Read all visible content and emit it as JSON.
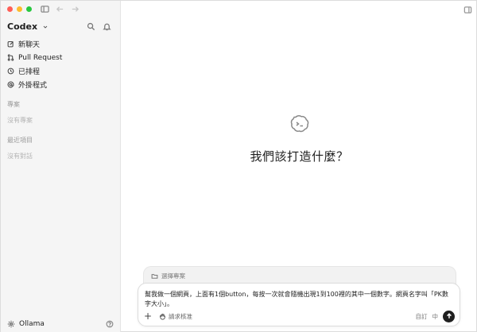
{
  "sidebar": {
    "brand": "Codex",
    "nav": [
      {
        "icon": "edit-icon",
        "label": "新聊天"
      },
      {
        "icon": "pull-request-icon",
        "label": "Pull Request"
      },
      {
        "icon": "clock-icon",
        "label": "已排程"
      },
      {
        "icon": "at-icon",
        "label": "外掛程式"
      }
    ],
    "projects_title": "專案",
    "projects_empty": "沒有專案",
    "recent_title": "最近項目",
    "recent_empty": "沒有對話",
    "footer_label": "Ollama"
  },
  "main": {
    "heading": "我們該打造什麼？"
  },
  "composer": {
    "project_label": "選擇專案",
    "prompt": "幫我做一個網頁，上面有1個button，每按一次就會隨機出現1到100裡的其中一個數字。網頁名字叫「PK數字大小」。",
    "permission_label": "請求核准",
    "mode_label": "自訂",
    "lang_label": "中"
  },
  "colors": {
    "sidebar_bg": "#f5f5f5",
    "send_button": "#1f1f1f",
    "traffic_red": "#ff5f57",
    "traffic_yellow": "#febc2e",
    "traffic_green": "#28c840"
  }
}
